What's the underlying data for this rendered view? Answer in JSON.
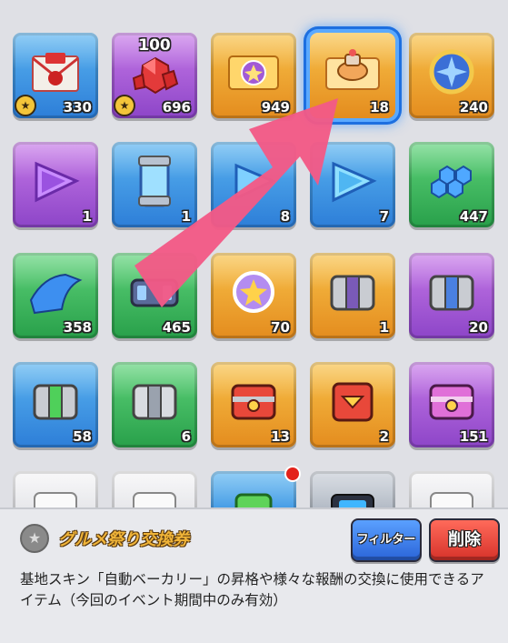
{
  "colors": {
    "accent_selected": "#1d6fe0",
    "arrow": "#f25a86",
    "item_name": "#f0b438",
    "filter_button": "#2a64d8",
    "delete_button": "#d6322a"
  },
  "grid": {
    "items": [
      {
        "icon": "letter-icon",
        "bg": "blue",
        "qty": "330",
        "star": true
      },
      {
        "icon": "red-gem-icon",
        "bg": "purple",
        "qty": "696",
        "star": true,
        "top_label": "100"
      },
      {
        "icon": "ticket-icon",
        "bg": "gold",
        "qty": "949"
      },
      {
        "icon": "gourmet-ticket-icon",
        "bg": "gold",
        "qty": "18",
        "selected": true
      },
      {
        "icon": "blue-star-medal-icon",
        "bg": "gold",
        "qty": "240"
      },
      {
        "icon": "purple-triangle-icon",
        "bg": "purple",
        "qty": "1"
      },
      {
        "icon": "capsule-icon",
        "bg": "blue",
        "qty": "1"
      },
      {
        "icon": "hidden-item-icon",
        "bg": "blue",
        "qty": "8"
      },
      {
        "icon": "blue-triangle-icon",
        "bg": "blue",
        "qty": "7"
      },
      {
        "icon": "hexagon-blocks-icon",
        "bg": "green",
        "qty": "447"
      },
      {
        "icon": "blue-sheet-icon",
        "bg": "green",
        "qty": "358"
      },
      {
        "icon": "connector-icon",
        "bg": "blue",
        "qty": "465"
      },
      {
        "icon": "emblem-icon",
        "bg": "gold",
        "qty": "70"
      },
      {
        "icon": "grey-chest-icon",
        "bg": "gold",
        "qty": "1"
      },
      {
        "icon": "purple-chest-icon",
        "bg": "purple",
        "qty": "20"
      },
      {
        "icon": "green-chest-icon",
        "bg": "blue",
        "qty": "58"
      },
      {
        "icon": "silver-chest-icon",
        "bg": "green",
        "qty": "6"
      },
      {
        "icon": "red-chest-icon",
        "bg": "gold",
        "qty": "13"
      },
      {
        "icon": "red-cube-icon",
        "bg": "gold",
        "qty": "2"
      },
      {
        "icon": "pink-chest-icon",
        "bg": "purple",
        "qty": "151"
      },
      {
        "icon": "white-box-icon",
        "bg": "white",
        "qty": ""
      },
      {
        "icon": "white-box-icon",
        "bg": "white",
        "qty": ""
      },
      {
        "icon": "green-capsule-icon",
        "bg": "blue",
        "qty": "",
        "notification": true
      },
      {
        "icon": "device-icon",
        "bg": "grey",
        "qty": ""
      },
      {
        "icon": "white-box-icon",
        "bg": "white",
        "qty": ""
      }
    ]
  },
  "detail": {
    "icon": "star-coin-icon",
    "item_name": "グルメ祭り交換券",
    "description": "基地スキン「自動ベーカリー」の昇格や様々な報酬の交換に使用できるアイテム（今回のイベント期間中のみ有効）"
  },
  "buttons": {
    "filter_label": "フィルター",
    "delete_label": "削除"
  }
}
